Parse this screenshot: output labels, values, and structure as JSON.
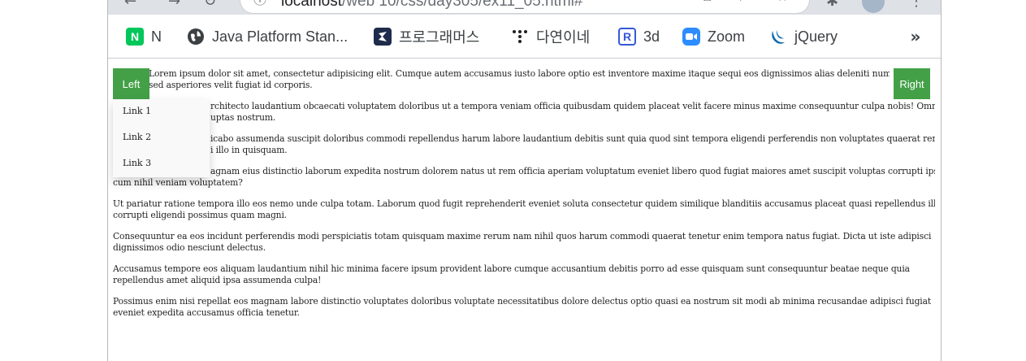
{
  "browser": {
    "url_host": "localhost",
    "url_path": "/web 10/css/day305/ex11_05.html#"
  },
  "bookmarks": [
    {
      "label": "N",
      "icon": "naver-icon",
      "color": "#03c75a",
      "glyph": "N"
    },
    {
      "label": "Java Platform Stan...",
      "icon": "globe-icon",
      "color": "#3c4043",
      "glyph": ""
    },
    {
      "label": "프로그래머스",
      "icon": "programmers-icon",
      "color": "#1e2b4a",
      "glyph": ""
    },
    {
      "label": "다연이네",
      "icon": "dots-icon",
      "color": "#202124",
      "glyph": ""
    },
    {
      "label": "3d",
      "icon": "r-logo-icon",
      "color": "#3658d8",
      "glyph": "R"
    },
    {
      "label": "Zoom",
      "icon": "zoom-icon",
      "color": "#2d8cff",
      "glyph": ""
    },
    {
      "label": "jQuery",
      "icon": "jquery-icon",
      "color": "#0868ac",
      "glyph": ""
    }
  ],
  "bookmarks_more": "»",
  "page": {
    "left_button": "Left",
    "right_button": "Right",
    "dropdown_links": [
      "Link 1",
      "Link 2",
      "Link 3"
    ],
    "paragraphs": [
      [
        "Lorem ipsum dolor sit amet, consectetur adipisicing elit. Cumque autem accusamus iusto labore optio est inventore maxime itaque sequi eos dignissimos alias deleniti numquam",
        "sed asperiores velit fugiat id corporis."
      ],
      [
        "rchitecto laudantium obcaecati voluptatem doloribus ut a tempora veniam officia quibusdam quidem placeat velit facere minus maxime consequuntur culpa nobis! Omnis",
        "uptas nostrum."
      ],
      [
        "icabo assumenda suscipit doloribus commodi repellendus harum labore laudantium debitis sunt quia quod sint tempora eligendi perferendis non voluptates quaerat rerum",
        "i illo in quisquam."
      ],
      [
        "agnam eius distinctio laborum expedita nostrum dolorem natus ut rem officia aperiam voluptatum eveniet libero quod fugiat maiores amet suscipit voluptas corrupti ipsam",
        "cum nihil veniam voluptatem?"
      ],
      [
        "Ut pariatur ratione tempora illo eos nemo unde culpa totam. Laborum quod fugit reprehenderit eveniet soluta consectetur quidem similique blanditiis accusamus placeat quasi repellendus illo",
        "corrupti eligendi possimus quam magni."
      ],
      [
        "Consequuntur ea eos incidunt perferendis modi perspiciatis totam quisquam maxime rerum nam nihil quos harum commodi quaerat tenetur enim tempora natus fugiat. Dicta ut iste adipisci",
        "dignissimos odio nesciunt delectus."
      ],
      [
        "Accusamus tempore eos aliquam laudantium nihil hic minima facere ipsum provident labore cumque accusantium debitis porro ad esse quisquam sunt consequuntur beatae neque quia",
        "repellendus amet aliquid ipsa assumenda culpa!"
      ],
      [
        "Possimus enim nisi repellat eos magnam labore distinctio voluptates doloribus voluptate necessitatibus dolore delectus optio quasi ea nostrum sit modi ab minima recusandae adipisci fugiat",
        "eveniet expedita accusamus officia tenetur."
      ]
    ]
  },
  "colors": {
    "button_green": "#43a047",
    "toolbar_bg": "#dee1e6"
  }
}
